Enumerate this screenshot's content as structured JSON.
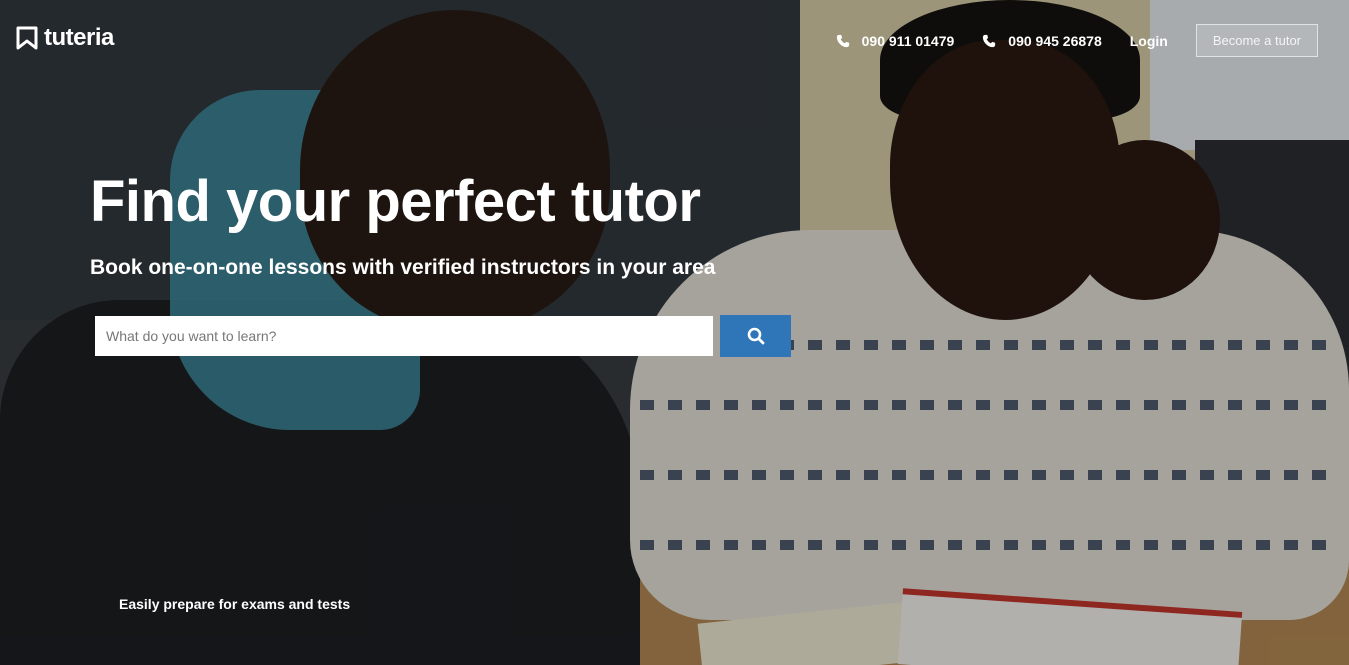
{
  "header": {
    "logo_text": "tuteria",
    "phone_1": "090 911 01479",
    "phone_2": "090 945 26878",
    "login_label": "Login",
    "become_tutor_label": "Become a tutor"
  },
  "hero": {
    "title": "Find your perfect tutor",
    "subtitle": "Book one-on-one lessons with verified instructors in your area",
    "search_placeholder": "What do you want to learn?",
    "search_value": "",
    "tagline": "Easily prepare for exams and tests"
  },
  "colors": {
    "search_button": "#2f76b8",
    "text": "#ffffff"
  },
  "icons": {
    "logo": "bookmark-logo-icon",
    "phone": "phone-icon",
    "search": "search-icon"
  }
}
